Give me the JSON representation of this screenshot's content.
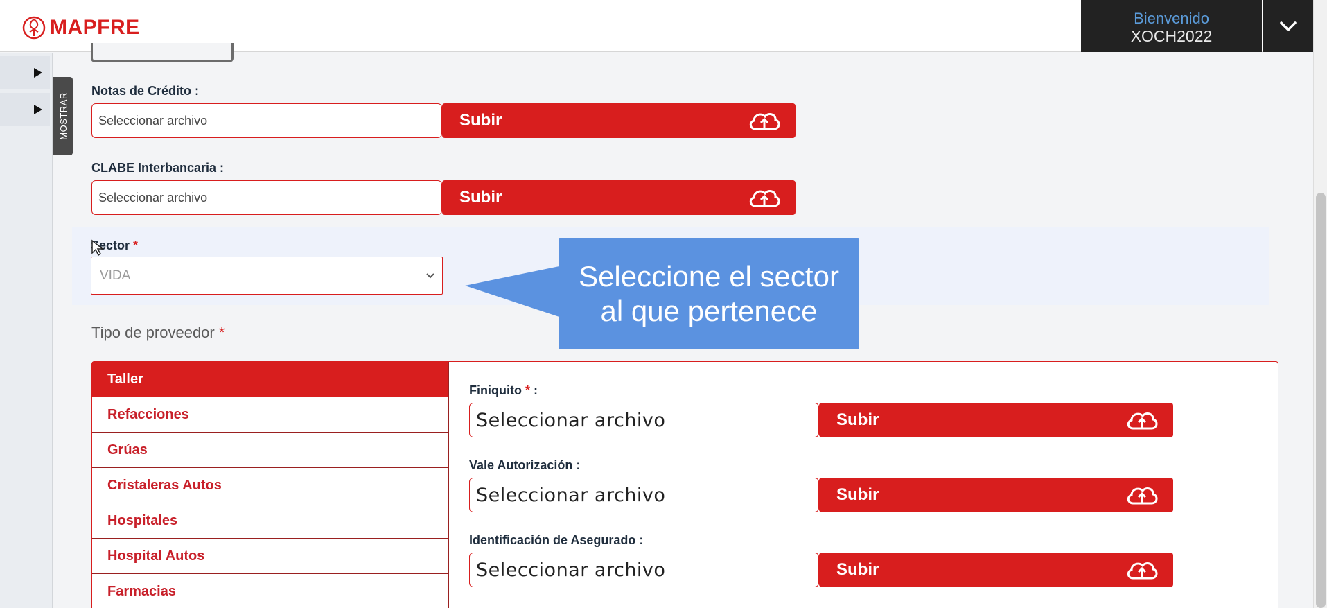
{
  "header": {
    "logo_text": "MAPFRE",
    "greeting": "Bienvenido",
    "username": "XOCH2022",
    "toggle_icon": "chevron-down-icon"
  },
  "sidebar": {
    "mostrar_label": "MOSTRAR",
    "items": [
      {
        "icon": "caret-right-icon"
      },
      {
        "icon": "caret-right-icon"
      }
    ]
  },
  "uploads_top": [
    {
      "label": "Notas de Crédito :",
      "placeholder": "Seleccionar archivo",
      "button": "Subir"
    },
    {
      "label": "CLABE Interbancaria :",
      "placeholder": "Seleccionar archivo",
      "button": "Subir"
    }
  ],
  "sector": {
    "label": "Sector",
    "required_mark": "*",
    "selected": "VIDA"
  },
  "tooltip": {
    "line1": "Seleccione el sector",
    "line2": "al que pertenece"
  },
  "tipo_proveedor": {
    "label": "Tipo de proveedor",
    "required_mark": "*",
    "options": [
      "Taller",
      "Refacciones",
      "Grúas",
      "Cristaleras Autos",
      "Hospitales",
      "Hospital Autos",
      "Farmacias"
    ],
    "active_index": 0
  },
  "taller_uploads": [
    {
      "label": "Finiquito",
      "required_mark": "*",
      "suffix": " :",
      "placeholder": "Seleccionar archivo",
      "button": "Subir"
    },
    {
      "label": "Vale Autorización :",
      "placeholder": "Seleccionar archivo",
      "button": "Subir"
    },
    {
      "label": "Identificación de Asegurado :",
      "placeholder": "Seleccionar archivo",
      "button": "Subir"
    }
  ],
  "colors": {
    "brand_red": "#d81e1e",
    "tooltip_blue": "#5b92e0",
    "header_dark": "#222222",
    "greeting_blue": "#5b9bd9"
  }
}
